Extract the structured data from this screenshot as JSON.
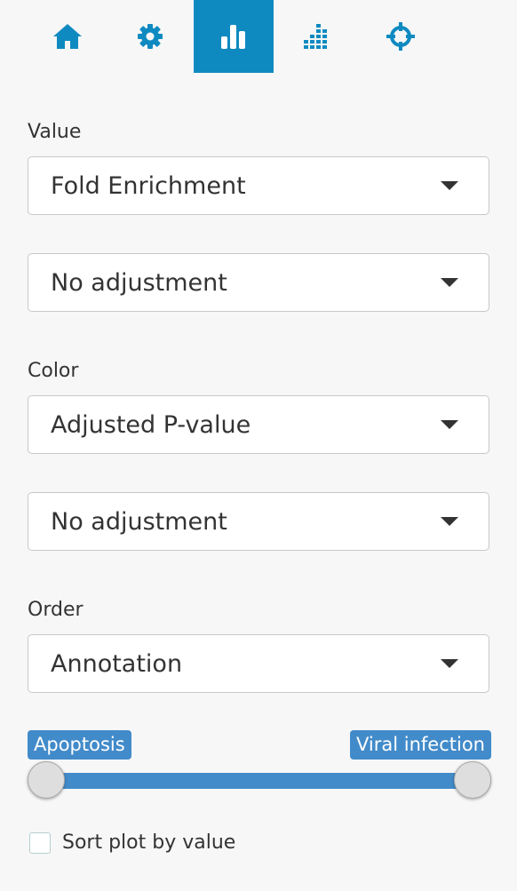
{
  "tabs": [
    {
      "icon": "home-icon",
      "active": false
    },
    {
      "icon": "gear-icon",
      "active": false
    },
    {
      "icon": "bar-chart-icon",
      "active": true
    },
    {
      "icon": "stacked-bars-icon",
      "active": false
    },
    {
      "icon": "crosshairs-icon",
      "active": false
    }
  ],
  "value_section": {
    "label": "Value",
    "select": "Fold Enrichment",
    "adjustment": "No adjustment"
  },
  "color_section": {
    "label": "Color",
    "select": "Adjusted P-value",
    "adjustment": "No adjustment"
  },
  "order_section": {
    "label": "Order",
    "select": "Annotation"
  },
  "range_slider": {
    "from_label": "Apoptosis",
    "to_label": "Viral infection",
    "from_fraction": 0,
    "to_fraction": 1
  },
  "sort_checkbox": {
    "label": "Sort plot by value",
    "checked": false
  },
  "colors": {
    "active_tab": "#0f8ac1",
    "icon": "#0f8ac1",
    "active_icon": "#ffffff",
    "slider_accent": "#428bca",
    "background": "#f7f7f7"
  }
}
